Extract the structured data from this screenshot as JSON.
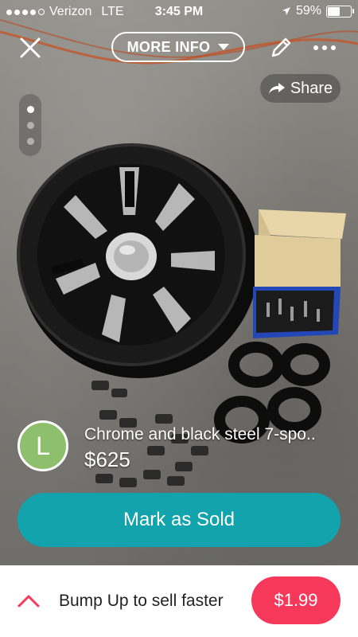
{
  "status_bar": {
    "carrier": "Verizon",
    "network": "LTE",
    "time": "3:45 PM",
    "battery": "59%",
    "battery_level": 0.59
  },
  "topbar": {
    "close_icon": "close-icon",
    "more_info_label": "MORE INFO",
    "edit_icon": "pencil-icon",
    "more_icon": "more-dots-icon"
  },
  "share": {
    "label": "Share",
    "icon": "share-arrow-icon"
  },
  "page_indicator": {
    "count": 3,
    "active": 0
  },
  "listing": {
    "avatar_letter": "L",
    "avatar_color": "#8dbf6d",
    "title": "Chrome and black steel 7-spo..",
    "price": "$625"
  },
  "mark_sold": {
    "label": "Mark as Sold",
    "color": "#12a3ad"
  },
  "bump": {
    "text": "Bump Up to sell faster",
    "price_label": "$1.99",
    "price_color": "#f6385a"
  }
}
